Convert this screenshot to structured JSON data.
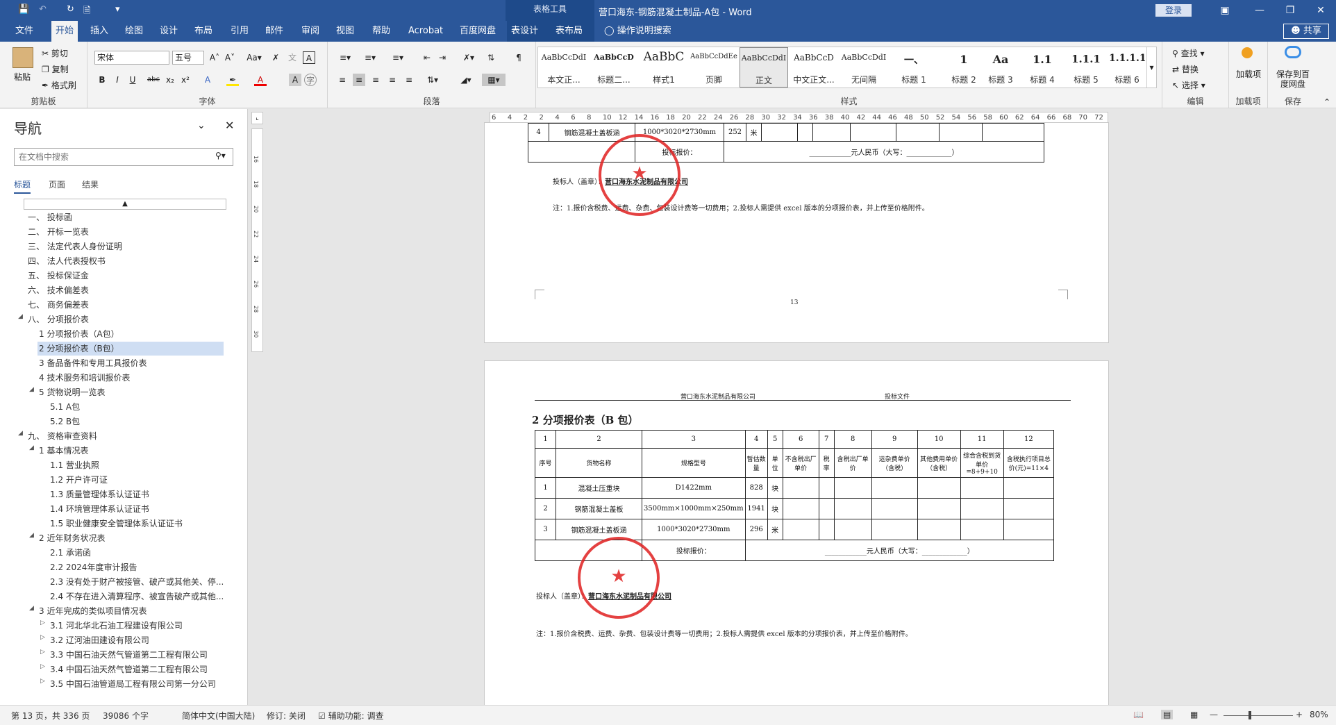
{
  "titlebar": {
    "context_group": "表格工具",
    "doc_title": "营口海东-钢筋混凝土制品-A包 - Word",
    "signin": "登录"
  },
  "menu": {
    "tabs": [
      "文件",
      "开始",
      "插入",
      "绘图",
      "设计",
      "布局",
      "引用",
      "邮件",
      "审阅",
      "视图",
      "帮助",
      "Acrobat",
      "百度网盘",
      "表设计",
      "表布局"
    ],
    "active": "开始",
    "tell_me": "操作说明搜索",
    "share": "共享"
  },
  "ribbon": {
    "clipboard": {
      "paste": "粘贴",
      "cut": "剪切",
      "copy": "复制",
      "format_painter": "格式刷",
      "label": "剪贴板"
    },
    "font": {
      "name": "宋体",
      "size": "五号",
      "label": "字体"
    },
    "paragraph": {
      "label": "段落"
    },
    "styles": {
      "label": "样式",
      "items": [
        {
          "preview": "AaBbCcDdI",
          "name": "本文正..."
        },
        {
          "preview": "AaBbCcD",
          "name": "标题二..."
        },
        {
          "preview": "AaBbC",
          "name": "样式1"
        },
        {
          "preview": "AaBbCcDdEe",
          "name": "页脚"
        },
        {
          "preview": "AaBbCcDdI",
          "name": "正文"
        },
        {
          "preview": "AaBbCcD",
          "name": "中文正文..."
        },
        {
          "preview": "AaBbCcDdI",
          "name": "无间隔"
        },
        {
          "preview": "一、",
          "name": "标题 1"
        },
        {
          "preview": "1",
          "name": "标题 2"
        },
        {
          "preview": "Aa",
          "name": "标题 3"
        },
        {
          "preview": "1.1",
          "name": "标题 4"
        },
        {
          "preview": "1.1.1",
          "name": "标题 5"
        },
        {
          "preview": "1.1.1.1",
          "name": "标题 6"
        }
      ],
      "selected_index": 4
    },
    "editing": {
      "find": "查找",
      "replace": "替换",
      "select": "选择",
      "label": "编辑"
    },
    "addin": {
      "name": "加载项",
      "label": "加载项"
    },
    "save": {
      "name": "保存到百度网盘",
      "label": "保存"
    }
  },
  "nav": {
    "title": "导航",
    "search_placeholder": "在文档中搜索",
    "tabs": [
      "标题",
      "页面",
      "结果"
    ],
    "tree": [
      {
        "text": "一、 投标函",
        "level": 0
      },
      {
        "text": "二、 开标一览表",
        "level": 0
      },
      {
        "text": "三、 法定代表人身份证明",
        "level": 0
      },
      {
        "text": "四、 法人代表授权书",
        "level": 0
      },
      {
        "text": "五、 投标保证金",
        "level": 0
      },
      {
        "text": "六、 技术偏差表",
        "level": 0
      },
      {
        "text": "七、 商务偏差表",
        "level": 0
      },
      {
        "text": "八、 分项报价表",
        "level": 0,
        "expanded": true
      },
      {
        "text": "1 分项报价表（A包）",
        "level": 1
      },
      {
        "text": "2 分项报价表（B包）",
        "level": 1,
        "selected": true
      },
      {
        "text": "3 备品备件和专用工具报价表",
        "level": 1
      },
      {
        "text": "4 技术服务和培训报价表",
        "level": 1
      },
      {
        "text": "5 货物说明一览表",
        "level": 1,
        "expanded": true
      },
      {
        "text": "5.1 A包",
        "level": 2
      },
      {
        "text": "5.2 B包",
        "level": 2
      },
      {
        "text": "九、 资格审查资料",
        "level": 0,
        "expanded": true
      },
      {
        "text": "1 基本情况表",
        "level": 1,
        "expanded": true
      },
      {
        "text": "1.1 营业执照",
        "level": 2
      },
      {
        "text": "1.2 开户许可证",
        "level": 2
      },
      {
        "text": "1.3 质量管理体系认证证书",
        "level": 2
      },
      {
        "text": "1.4 环境管理体系认证证书",
        "level": 2
      },
      {
        "text": "1.5 职业健康安全管理体系认证证书",
        "level": 2
      },
      {
        "text": "2 近年财务状况表",
        "level": 1,
        "expanded": true
      },
      {
        "text": "2.1 承诺函",
        "level": 2
      },
      {
        "text": "2.2 2024年度审计报告",
        "level": 2
      },
      {
        "text": "2.3 没有处于财产被接管、破产或其他关、停...",
        "level": 2
      },
      {
        "text": "2.4 不存在进入清算程序、被宣告破产或其他...",
        "level": 2
      },
      {
        "text": "3 近年完成的类似项目情况表",
        "level": 1,
        "expanded": true
      },
      {
        "text": "3.1 河北华北石油工程建设有限公司",
        "level": 2,
        "collapsed": true
      },
      {
        "text": "3.2 辽河油田建设有限公司",
        "level": 2,
        "collapsed": true
      },
      {
        "text": "3.3 中国石油天然气管道第二工程有限公司",
        "level": 2,
        "collapsed": true
      },
      {
        "text": "3.4 中国石油天然气管道第二工程有限公司",
        "level": 2,
        "collapsed": true
      },
      {
        "text": "3.5 中国石油管道局工程有限公司第一分公司",
        "level": 2,
        "collapsed": true
      }
    ]
  },
  "rulers": {
    "h_ticks": [
      "6",
      "4",
      "2",
      "2",
      "4",
      "6",
      "8",
      "10",
      "12",
      "14",
      "16",
      "18",
      "20",
      "22",
      "24",
      "26",
      "28",
      "30",
      "32",
      "34",
      "36",
      "38",
      "40",
      "42",
      "44",
      "46",
      "48",
      "50",
      "52",
      "54",
      "56",
      "58",
      "60",
      "62",
      "64",
      "66",
      "68",
      "70",
      "72"
    ],
    "v_ticks": [
      "16",
      "18",
      "20",
      "22",
      "24",
      "26",
      "28",
      "30"
    ]
  },
  "page1": {
    "row": {
      "no": "4",
      "name": "钢筋混凝土盖板涵",
      "spec": "1000*3020*2730mm",
      "qty": "252",
      "unit": "米"
    },
    "total_label": "投标报价：",
    "total_value": "____________元人民币（大写：_____________）",
    "bidder_label": "投标人（盖章）：",
    "bidder_name": "营口海东水泥制品有限公司",
    "note": "注：1.报价含税费、运费、杂费、包装设计费等一切费用；2.投标人需提供 excel 版本的分项报价表，并上传至价格附件。",
    "page_no": "13",
    "stamp_text": "营口海东水泥制品有限公司"
  },
  "page2": {
    "header_left": "营口海东水泥制品有限公司",
    "header_right": "投标文件",
    "heading": "2 分项报价表（B 包）",
    "col_nums": [
      "1",
      "2",
      "3",
      "4",
      "5",
      "6",
      "7",
      "8",
      "9",
      "10",
      "11",
      "12"
    ],
    "col_heads": [
      "序号",
      "货物名称",
      "规格型号",
      "暂估数量",
      "单位",
      "不含税出厂单价",
      "税率",
      "含税出厂单价",
      "运杂费单价（含税）",
      "其他费用单价（含税）",
      "综合含税到货单价=8+9+10",
      "含税执行项目总价(元)=11×4"
    ],
    "rows": [
      {
        "no": "1",
        "name": "混凝土压重块",
        "spec": "D1422mm",
        "qty": "828",
        "unit": "块"
      },
      {
        "no": "2",
        "name": "钢筋混凝土盖板",
        "spec": "3500mm×1000mm×250mm",
        "qty": "1941",
        "unit": "块"
      },
      {
        "no": "3",
        "name": "钢筋混凝土盖板涵",
        "spec": "1000*3020*2730mm",
        "qty": "296",
        "unit": "米"
      }
    ],
    "total_label": "投标报价：",
    "total_value": "____________元人民币（大写：_____________）",
    "bidder_label": "投标人（盖章）：",
    "bidder_name": "营口海东水泥制品有限公司",
    "note": "注：1.报价含税费、运费、杂费、包装设计费等一切费用；2.投标人需提供 excel 版本的分项报价表，并上传至价格附件。",
    "stamp_text": "营口海东水泥制品有限公司"
  },
  "status": {
    "page": "第 13 页，共 336 页",
    "words": "39086 个字",
    "lang": "简体中文(中国大陆)",
    "revision": "修订: 关闭",
    "accessibility": "辅助功能: 调查",
    "zoom": "80%"
  }
}
